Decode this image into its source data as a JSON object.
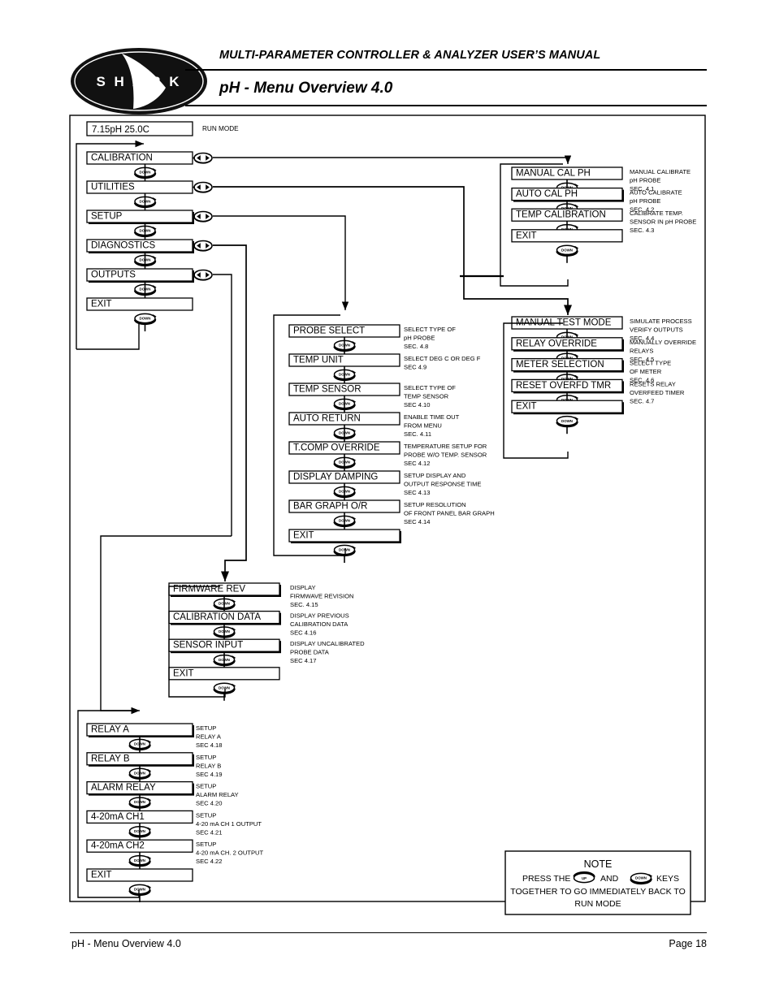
{
  "header": {
    "title": "MULTI-PARAMETER CONTROLLER & ANALYZER USER’S MANUAL",
    "subtitle": "pH - Menu Overview 4.0",
    "logo_text": "SHARK",
    "logo_letters": "S  H  A  R  K"
  },
  "footer": {
    "left": "pH - Menu Overview 4.0",
    "right": "Page 18"
  },
  "keys": {
    "down_label": "DOWN",
    "up_label": "UP",
    "leftright_label": "left-right-arrows"
  },
  "run_mode_label": "RUN MODE",
  "display": {
    "value": "7.15pH  25.0C"
  },
  "main_menu": {
    "name": "main-menu",
    "items": [
      {
        "label": "CALIBRATION",
        "has_lr_key": true,
        "shadow": false
      },
      {
        "label": "UTILITIES",
        "has_lr_key": true,
        "shadow": false
      },
      {
        "label": "SETUP",
        "has_lr_key": true,
        "shadow": true
      },
      {
        "label": "DIAGNOSTICS",
        "has_lr_key": true,
        "shadow": true
      },
      {
        "label": "OUTPUTS",
        "has_lr_key": true,
        "shadow": true
      },
      {
        "label": "EXIT",
        "has_lr_key": false,
        "shadow": false
      }
    ]
  },
  "calibration_menu": {
    "name": "calibration-submenu",
    "items": [
      {
        "label": "MANUAL CAL PH",
        "shadow": false,
        "desc": [
          "MANUAL CALIBRATE",
          "pH PROBE",
          "SEC. 4.1"
        ]
      },
      {
        "label": "AUTO CAL PH",
        "shadow": true,
        "desc": [
          "AUTO CALIBRATE",
          "pH PROBE",
          "SEC. 4.2"
        ]
      },
      {
        "label": "TEMP CALIBRATION",
        "shadow": false,
        "desc": [
          "CALIBRATE TEMP.",
          "SENSOR IN pH PROBE",
          "SEC. 4.3"
        ]
      },
      {
        "label": "EXIT",
        "shadow": false,
        "desc": []
      }
    ]
  },
  "utilities_menu": {
    "name": "utilities-submenu",
    "items": [
      {
        "label": "MANUAL TEST MODE",
        "shadow": false,
        "desc": [
          "SIMULATE PROCESS",
          "VERIFY OUTPUTS",
          "SEC. 4.4"
        ]
      },
      {
        "label": "RELAY OVERRIDE",
        "shadow": true,
        "desc": [
          "MANUALLY OVERRIDE",
          "RELAYS",
          "SEC. 4.5"
        ]
      },
      {
        "label": "METER SELECTION",
        "shadow": true,
        "desc": [
          "SELECT TYPE",
          "OF METER",
          "SEC. 4.6"
        ]
      },
      {
        "label": "RESET OVERFD TMR",
        "shadow": true,
        "desc": [
          "RESETS RELAY",
          "OVERFEED TIMER",
          "SEC. 4.7"
        ]
      },
      {
        "label": "EXIT",
        "shadow": true,
        "desc": []
      }
    ]
  },
  "setup_menu": {
    "name": "setup-submenu",
    "items": [
      {
        "label": "PROBE SELECT",
        "shadow": false,
        "desc": [
          "SELECT TYPE OF",
          "pH  PROBE",
          "SEC. 4.8"
        ]
      },
      {
        "label": "TEMP UNIT",
        "shadow": false,
        "desc": [
          "SELECT DEG C OR DEG F",
          "SEC 4.9"
        ]
      },
      {
        "label": "TEMP SENSOR",
        "shadow": false,
        "desc": [
          "SELECT TYPE OF",
          "TEMP SENSOR",
          "SEC 4.10"
        ]
      },
      {
        "label": "AUTO RETURN",
        "shadow": false,
        "desc": [
          "ENABLE TIME OUT",
          "FROM MENU",
          "SEC. 4.11"
        ]
      },
      {
        "label": "T.COMP OVERRIDE",
        "shadow": false,
        "desc": [
          "TEMPERATURE SETUP FOR",
          "PROBE W/O TEMP. SENSOR",
          "SEC 4.12"
        ]
      },
      {
        "label": "DISPLAY DAMPING",
        "shadow": false,
        "desc": [
          "SETUP DISPLAY AND",
          "OUTPUT RESPONSE TIME",
          "SEC 4.13"
        ]
      },
      {
        "label": "BAR GRAPH O/R",
        "shadow": false,
        "desc": [
          "SETUP RESOLUTION",
          "OF FRONT PANEL BAR GRAPH",
          "SEC 4.14"
        ]
      },
      {
        "label": "EXIT",
        "shadow": true,
        "desc": []
      }
    ]
  },
  "diagnostics_menu": {
    "name": "diagnostics-submenu",
    "items": [
      {
        "label": "FIRMWARE REV",
        "shadow": true,
        "desc": [
          "DISPLAY",
          "FIRMWAVE REVISION",
          "SEC. 4.15"
        ]
      },
      {
        "label": "CALIBRATION DATA",
        "shadow": true,
        "desc": [
          "DISPLAY  PREVIOUS",
          "CALIBRATION DATA",
          "SEC 4.16"
        ]
      },
      {
        "label": "SENSOR INPUT",
        "shadow": true,
        "desc": [
          "DISPLAY UNCALIBRATED",
          "PROBE DATA",
          "SEC 4.17"
        ]
      },
      {
        "label": "EXIT",
        "shadow": false,
        "desc": []
      }
    ]
  },
  "outputs_menu": {
    "name": "outputs-submenu",
    "items": [
      {
        "label": "RELAY A",
        "shadow": true,
        "desc": [
          "SETUP",
          "RELAY A",
          "SEC 4.18"
        ]
      },
      {
        "label": "RELAY B",
        "shadow": true,
        "desc": [
          "SETUP",
          "RELAY B",
          "SEC 4.19"
        ]
      },
      {
        "label": "ALARM RELAY",
        "shadow": true,
        "desc": [
          "SETUP",
          "ALARM RELAY",
          "SEC 4.20"
        ]
      },
      {
        "label": "4-20mA CH1",
        "shadow": false,
        "desc": [
          "SETUP",
          "4-20 mA CH 1 OUTPUT",
          "SEC 4.21"
        ]
      },
      {
        "label": "4-20mA CH2",
        "shadow": false,
        "desc": [
          "SETUP",
          "4-20 mA CH. 2 OUTPUT",
          "SEC 4.22"
        ]
      },
      {
        "label": "EXIT",
        "shadow": false,
        "desc": []
      }
    ]
  },
  "note": {
    "title": "NOTE",
    "line1_a": "PRESS THE",
    "line1_b": "AND",
    "line1_c": "KEYS",
    "line2": "TOGETHER TO GO IMMEDIATELY BACK TO",
    "line3": "RUN MODE"
  }
}
